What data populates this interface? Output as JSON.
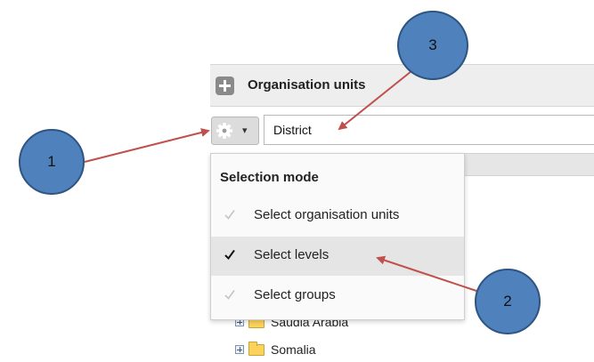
{
  "panel": {
    "title": "Organisation units"
  },
  "level_input": {
    "value": "District"
  },
  "selection_menu": {
    "header": "Selection mode",
    "items": [
      {
        "label": "Select organisation units",
        "checked": false
      },
      {
        "label": "Select levels",
        "checked": true
      },
      {
        "label": "Select groups",
        "checked": false
      }
    ]
  },
  "tree": {
    "items": [
      {
        "label": "Saudia Arabia"
      },
      {
        "label": "Somalia"
      }
    ]
  },
  "callouts": {
    "one": "1",
    "two": "2",
    "three": "3"
  },
  "colors": {
    "callout_fill": "#4f81bd",
    "callout_border": "#2e5481",
    "arrow": "#c0504d",
    "menu_highlight": "#e5e5e5"
  }
}
